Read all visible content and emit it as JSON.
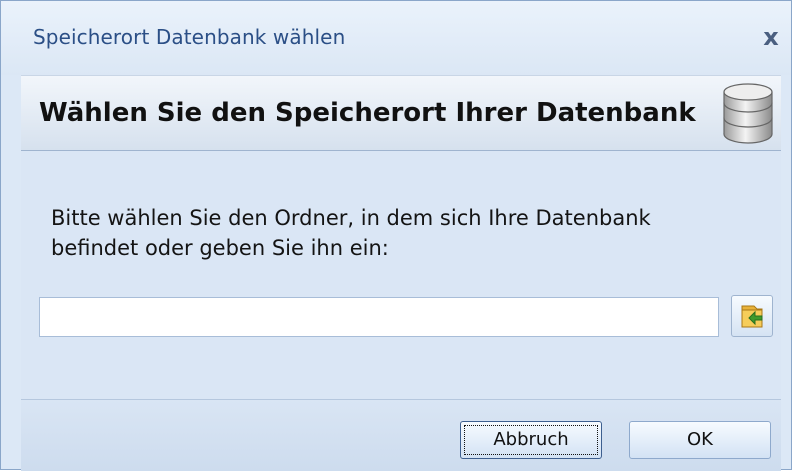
{
  "window": {
    "title": "Speicherort Datenbank wählen",
    "close_glyph": "x"
  },
  "header": {
    "title": "Wählen Sie den Speicherort Ihrer Datenbank",
    "icon": "database-icon"
  },
  "content": {
    "instruction": "Bitte wählen Sie den Ordner, in dem sich Ihre Datenbank befindet oder geben Sie ihn ein:",
    "path_value": "",
    "browse_icon": "folder-arrow-icon"
  },
  "footer": {
    "cancel_label": "Abbruch",
    "ok_label": "OK"
  },
  "colors": {
    "dialog_bg": "#dce8f6",
    "title_text": "#2b4f86"
  }
}
